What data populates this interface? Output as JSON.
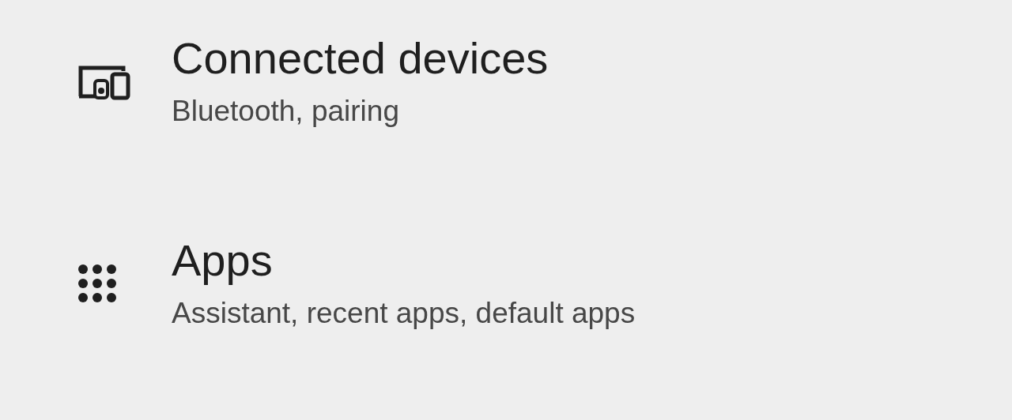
{
  "settings_items": [
    {
      "title": "Connected devices",
      "subtitle": "Bluetooth, pairing"
    },
    {
      "title": "Apps",
      "subtitle": "Assistant, recent apps, default apps"
    }
  ]
}
